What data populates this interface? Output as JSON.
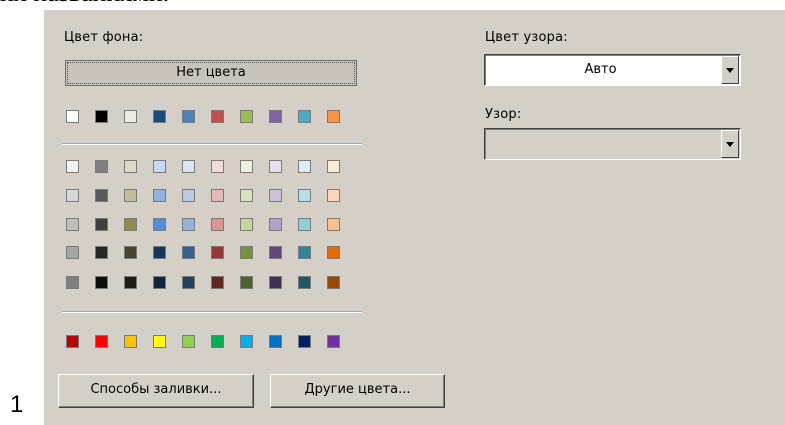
{
  "doc_fragment": "их названиями.",
  "page_number": "1",
  "fill": {
    "bg_label": "Цвет фона:",
    "no_color_button": "Нет цвета",
    "row_top": [
      "#ffffff",
      "#000000",
      "#eeece1",
      "#1f497d",
      "#4f81bd",
      "#c0504d",
      "#9bbb59",
      "#8064a2",
      "#4bacc6",
      "#f79646"
    ],
    "shade_rows": [
      [
        "#f2f2f2",
        "#7f7f7f",
        "#ddd9c3",
        "#c6d9f0",
        "#dbe5f1",
        "#f2dcdb",
        "#ebf1dd",
        "#e5e0ec",
        "#dbeef3",
        "#fdeada"
      ],
      [
        "#d8d8d8",
        "#595959",
        "#c4bd97",
        "#8db3e2",
        "#b8cce4",
        "#e5b9b7",
        "#d7e3bc",
        "#ccc1d9",
        "#b7dde8",
        "#fbd5b5"
      ],
      [
        "#bfbfbf",
        "#3f3f3f",
        "#938953",
        "#548dd4",
        "#95b3d7",
        "#d99694",
        "#c3d69b",
        "#b2a2c7",
        "#92cddc",
        "#fac08f"
      ],
      [
        "#a5a5a5",
        "#262626",
        "#494429",
        "#17365d",
        "#366092",
        "#953734",
        "#76923c",
        "#5f497a",
        "#31859b",
        "#e36c09"
      ],
      [
        "#7f7f7f",
        "#0c0c0c",
        "#1d1b10",
        "#0f243e",
        "#244061",
        "#632423",
        "#4f6128",
        "#3f3151",
        "#205867",
        "#974806"
      ]
    ],
    "row_standard": [
      "#c00000",
      "#ff0000",
      "#ffc000",
      "#ffff00",
      "#92d050",
      "#00b050",
      "#00b0f0",
      "#0070c0",
      "#002060",
      "#7030a0"
    ],
    "fill_effects_button": "Способы заливки...",
    "more_colors_button": "Другие цвета..."
  },
  "pattern": {
    "color_label": "Цвет узора:",
    "color_value": "Авто",
    "style_label": "Узор:",
    "style_value": ""
  }
}
